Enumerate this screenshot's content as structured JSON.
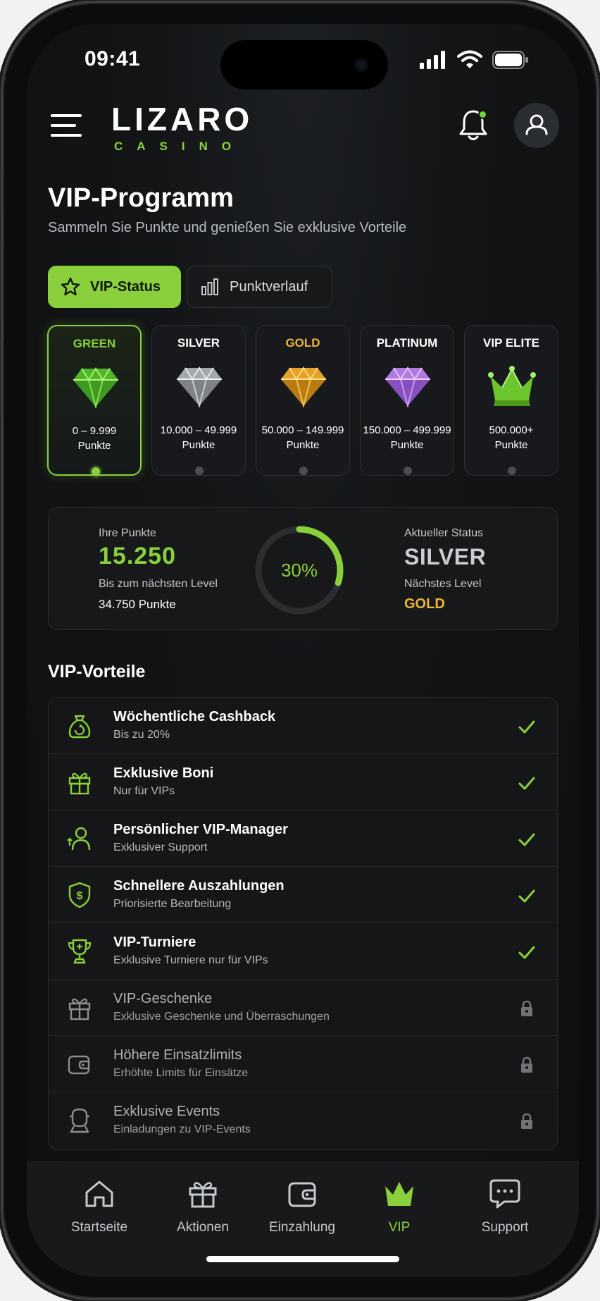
{
  "status_bar": {
    "time": "09:41"
  },
  "header": {
    "logo_main": "LIZARO",
    "logo_sub": "CASINO"
  },
  "page": {
    "title": "VIP-Programm",
    "subtitle": "Sammeln Sie Punkte und genießen Sie exklusive Vorteile"
  },
  "tabs": [
    {
      "label": "VIP-Status",
      "icon": "star-icon",
      "active": true
    },
    {
      "label": "Punktverlauf",
      "icon": "bar-chart-icon",
      "active": false
    }
  ],
  "tiers": [
    {
      "name": "GREEN",
      "range": "0 – 9.999",
      "unit": "Punkte",
      "color": "#8ad03c",
      "gem_color": "#5cc233",
      "active": true
    },
    {
      "name": "SILVER",
      "range": "10.000 – 49.999",
      "unit": "Punkte",
      "color": "#ffffff",
      "gem_color": "#b8bcc2",
      "active": false
    },
    {
      "name": "GOLD",
      "range": "50.000 – 149.999",
      "unit": "Punkte",
      "color": "#f0b43a",
      "gem_color": "#e5a22a",
      "active": false
    },
    {
      "name": "PLATINUM",
      "range": "150.000 – 499.999",
      "unit": "Punkte",
      "color": "#ffffff",
      "gem_color": "#b57ae6",
      "active": false
    },
    {
      "name": "VIP ELITE",
      "range": "500.000+",
      "unit": "Punkte",
      "color": "#ffffff",
      "gem_color": "#7ed23a",
      "active": false
    }
  ],
  "points": {
    "label": "Ihre Punkte",
    "value": "15.250",
    "next_label": "Bis zum nächsten Level",
    "next_value": "34.750 Punkte",
    "progress_percent": 30,
    "progress_text": "30%",
    "status_label": "Aktueller Status",
    "status_value": "SILVER",
    "next_level_label": "Nächstes Level",
    "next_level_value": "GOLD"
  },
  "benefits_title": "VIP-Vorteile",
  "benefits": [
    {
      "title": "Wöchentliche Cashback",
      "subtitle": "Bis zu 20%",
      "icon": "cashback-bag-icon",
      "unlocked": true
    },
    {
      "title": "Exklusive Boni",
      "subtitle": "Nur für VIPs",
      "icon": "gift-icon",
      "unlocked": true
    },
    {
      "title": "Persönlicher VIP-Manager",
      "subtitle": "Exklusiver Support",
      "icon": "manager-icon",
      "unlocked": true
    },
    {
      "title": "Schnellere Auszahlungen",
      "subtitle": "Priorisierte Bearbeitung",
      "icon": "shield-dollar-icon",
      "unlocked": true
    },
    {
      "title": "VIP-Turniere",
      "subtitle": "Exklusive Turniere nur für VIPs",
      "icon": "trophy-icon",
      "unlocked": true
    },
    {
      "title": "VIP-Geschenke",
      "subtitle": "Exklusive Geschenke und Überraschungen",
      "icon": "gift-icon",
      "unlocked": false
    },
    {
      "title": "Höhere Einsatzlimits",
      "subtitle": "Erhöhte Limits für Einsätze",
      "icon": "wallet-icon",
      "unlocked": false
    },
    {
      "title": "Exklusive Events",
      "subtitle": "Einladungen zu VIP-Events",
      "icon": "event-icon",
      "unlocked": false
    }
  ],
  "nav": [
    {
      "label": "Startseite",
      "icon": "home-icon",
      "active": false
    },
    {
      "label": "Aktionen",
      "icon": "gift-icon",
      "active": false
    },
    {
      "label": "Einzahlung",
      "icon": "wallet-icon",
      "active": false
    },
    {
      "label": "VIP",
      "icon": "crown-icon",
      "active": true
    },
    {
      "label": "Support",
      "icon": "chat-icon",
      "active": false
    }
  ],
  "colors": {
    "accent": "#8ad03c",
    "gold": "#f0b43a",
    "background": "#121416"
  }
}
